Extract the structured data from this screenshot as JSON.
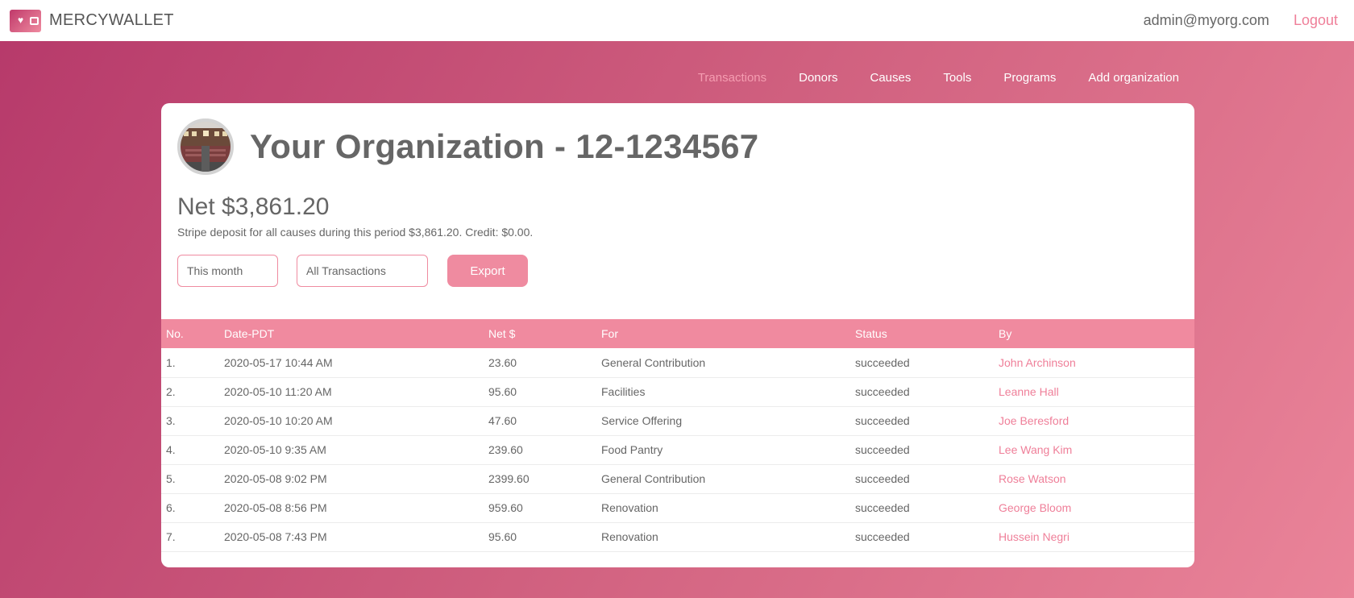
{
  "brand": {
    "name": "MERCYWALLET"
  },
  "user": {
    "email": "admin@myorg.com",
    "logout_label": "Logout"
  },
  "nav": {
    "items": [
      {
        "label": "Transactions",
        "active": true
      },
      {
        "label": "Donors",
        "active": false
      },
      {
        "label": "Causes",
        "active": false
      },
      {
        "label": "Tools",
        "active": false
      },
      {
        "label": "Programs",
        "active": false
      },
      {
        "label": "Add organization",
        "active": false
      }
    ]
  },
  "org": {
    "title": "Your Organization - 12-1234567",
    "net_label": "Net $3,861.20",
    "deposit_text": "Stripe deposit for all causes during this period $3,861.20. Credit: $0.00."
  },
  "filters": {
    "period_value": "This month",
    "type_value": "All Transactions",
    "export_label": "Export"
  },
  "table": {
    "headers": [
      "No.",
      "Date-PDT",
      "Net $",
      "For",
      "Status",
      "By"
    ],
    "rows": [
      [
        "1.",
        "2020-05-17 10:44 AM",
        "23.60",
        "General Contribution",
        "succeeded",
        "John Archinson"
      ],
      [
        "2.",
        "2020-05-10 11:20 AM",
        "95.60",
        "Facilities",
        "succeeded",
        "Leanne Hall"
      ],
      [
        "3.",
        "2020-05-10 10:20 AM",
        "47.60",
        "Service Offering",
        "succeeded",
        "Joe Beresford"
      ],
      [
        "4.",
        "2020-05-10 9:35 AM",
        "239.60",
        "Food Pantry",
        "succeeded",
        "Lee Wang Kim"
      ],
      [
        "5.",
        "2020-05-08 9:02 PM",
        "2399.60",
        "General Contribution",
        "succeeded",
        "Rose Watson"
      ],
      [
        "6.",
        "2020-05-08 8:56 PM",
        "959.60",
        "Renovation",
        "succeeded",
        "George Bloom"
      ],
      [
        "7.",
        "2020-05-08 7:43 PM",
        "95.60",
        "Renovation",
        "succeeded",
        "Hussein Negri"
      ]
    ]
  },
  "colors": {
    "accent": "#ef8ba0",
    "link": "#ef7f99",
    "nav_active": "#f59db1",
    "gradient_start": "#b6396a",
    "gradient_end": "#ea8499"
  },
  "icons": {
    "logo": "wallet-heart-icon",
    "avatar": "organization-photo"
  }
}
